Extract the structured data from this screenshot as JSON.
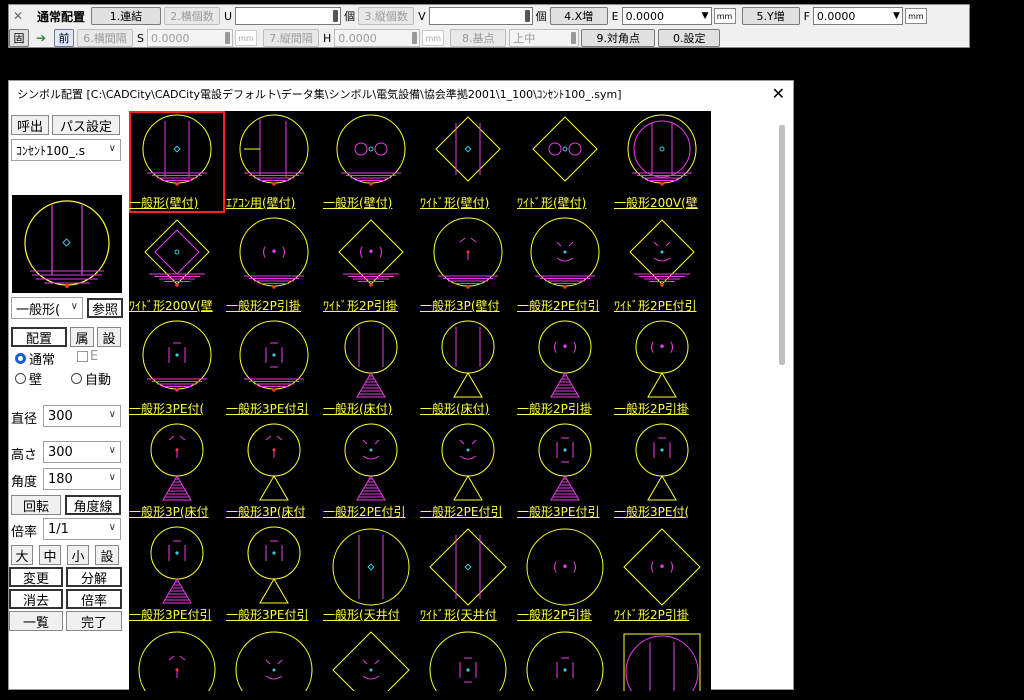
{
  "toolbar": {
    "title": "通常配置",
    "close_glyph": "✕",
    "row1": [
      {
        "label": "1.連結",
        "enabled": true
      },
      {
        "label": "2.横個数",
        "enabled": false
      }
    ],
    "u_label": "U",
    "u_unit": "個",
    "btn_tate": "3.縦個数",
    "v_label": "V",
    "v_unit": "個",
    "btn_xzo": "4.X増",
    "e_label": "E",
    "e_value": "0.0000",
    "btn_yzo": "5.Y増",
    "f_label": "F",
    "f_value": "0.0000",
    "mm": "mm",
    "row2_ko": "固",
    "row2_mae": "前",
    "btn_yokokan": "6.横間隔",
    "s_label": "S",
    "s_value": "0.0000",
    "btn_tatekan": "7.縦間隔",
    "h_label": "H",
    "h_value": "0.0000",
    "btn_kiten": "8.基点",
    "kiten_value": "上中",
    "btn_taikaku": "9.対角点",
    "btn_settei": "0.設定"
  },
  "dialog": {
    "title": "シンボル配置 [C:\\CADCity\\CADCity電設デフォルト\\データ集\\シンボル\\電気設備\\協会準拠2001\\1_100\\ｺﾝｾﾝﾄ100_.sym]",
    "close": "✕",
    "btn_yobidashi": "呼出",
    "btn_pass": "パス設定",
    "file_combo": "ｺﾝｾﾝﾄ100_.s",
    "name_combo": "一般形(",
    "btn_sansho": "参照",
    "tab_haichi": "配置",
    "tab_zoku": "属",
    "tab_setsu": "設",
    "radio_tsujo": "通常",
    "check_e": "E",
    "radio_kabe": "壁",
    "radio_jido": "自動",
    "lbl_chokkei": "直径",
    "chokkei": "300",
    "lbl_takasa": "高さ",
    "takasa": "300",
    "lbl_kakudo": "角度",
    "kakudo": "180",
    "btn_kaiten": "回転",
    "btn_kakudosen": "角度線",
    "lbl_bairitsu": "倍率",
    "bairitsu": "1/1",
    "btn_dai": "大",
    "btn_chu": "中",
    "btn_sho": "小",
    "btn_setsu2": "設",
    "btn_henko": "変更",
    "btn_bunkai": "分解",
    "btn_shokyo": "消去",
    "btn_bairitsu2": "倍率",
    "btn_ichiran": "一覧",
    "btn_kanryo": "完了"
  },
  "symbols": [
    {
      "label": "一般形(壁付)",
      "shape": "circle",
      "inner": "two-lines-dot",
      "base": "hatch",
      "selected": true
    },
    {
      "label": "ｴｱｺﾝ用(壁付)",
      "shape": "circle",
      "inner": "aircon",
      "base": "hatch"
    },
    {
      "label": "一般形(壁付)",
      "shape": "circle",
      "inner": "double",
      "base": "hatch"
    },
    {
      "label": "ﾜｲﾄﾞ形(壁付)",
      "shape": "diamond",
      "inner": "two-lines-dot",
      "base": "none"
    },
    {
      "label": "ﾜｲﾄﾞ形(壁付)",
      "shape": "diamond",
      "inner": "double",
      "base": "none"
    },
    {
      "label": "一般形200V(壁",
      "shape": "circle",
      "inner": "double-circle",
      "base": "hatch"
    },
    {
      "label": "ﾜｲﾄﾞ形200V(壁",
      "shape": "diamond",
      "inner": "diamond-inner",
      "base": "hatch"
    },
    {
      "label": "一般形2P引掛",
      "shape": "circle",
      "inner": "paren",
      "base": "hatch"
    },
    {
      "label": "ﾜｲﾄﾞ形2P引掛",
      "shape": "diamond",
      "inner": "paren",
      "base": "hatch"
    },
    {
      "label": "一般形3P(壁付",
      "shape": "circle",
      "inner": "3p",
      "base": "hatch"
    },
    {
      "label": "一般形2PE付引",
      "shape": "circle",
      "inner": "smile",
      "base": "hatch"
    },
    {
      "label": "ﾜｲﾄﾞ形2PE付引",
      "shape": "diamond",
      "inner": "smile",
      "base": "hatch"
    },
    {
      "label": "一般形3PE付(",
      "shape": "circle",
      "inner": "pe-box",
      "base": "hatch"
    },
    {
      "label": "一般形3PE付引",
      "shape": "circle",
      "inner": "pe-bar",
      "base": "hatch"
    },
    {
      "label": "一般形(床付)",
      "shape": "circle-small",
      "inner": "two-lines",
      "base": "tri-fill"
    },
    {
      "label": "一般形(床付)",
      "shape": "circle-small",
      "inner": "two-lines",
      "base": "tri"
    },
    {
      "label": "一般形2P引掛",
      "shape": "circle-small",
      "inner": "paren",
      "base": "tri-fill"
    },
    {
      "label": "一般形2P引掛",
      "shape": "circle-small",
      "inner": "paren",
      "base": "tri"
    },
    {
      "label": "一般形3P(床付",
      "shape": "circle-small",
      "inner": "3p",
      "base": "tri-fill"
    },
    {
      "label": "一般形3P(床付",
      "shape": "circle-small",
      "inner": "3p",
      "base": "tri"
    },
    {
      "label": "一般形2PE付引",
      "shape": "circle-small",
      "inner": "smile",
      "base": "tri-fill"
    },
    {
      "label": "一般形2PE付引",
      "shape": "circle-small",
      "inner": "smile",
      "base": "tri"
    },
    {
      "label": "一般形3PE付引",
      "shape": "circle-small",
      "inner": "pe-bar",
      "base": "tri-fill"
    },
    {
      "label": "一般形3PE付(",
      "shape": "circle-small",
      "inner": "pe-box",
      "base": "tri"
    },
    {
      "label": "一般形3PE付引",
      "shape": "circle-small",
      "inner": "pe-box",
      "base": "tri-fill"
    },
    {
      "label": "一般形3PE付引",
      "shape": "circle-small",
      "inner": "pe-box",
      "base": "tri"
    },
    {
      "label": "一般形(天井付",
      "shape": "circle-large",
      "inner": "two-lines-dot",
      "base": "none"
    },
    {
      "label": "ﾜｲﾄﾞ形(天井付",
      "shape": "diamond-large",
      "inner": "two-lines-dot",
      "base": "none"
    },
    {
      "label": "一般形2P引掛",
      "shape": "circle-large",
      "inner": "paren",
      "base": "none"
    },
    {
      "label": "ﾜｲﾄﾞ形2P引掛",
      "shape": "diamond-large",
      "inner": "paren",
      "base": "none"
    },
    {
      "label": "",
      "shape": "circle-large",
      "inner": "3p",
      "base": "none"
    },
    {
      "label": "",
      "shape": "circle-large",
      "inner": "smile",
      "base": "none"
    },
    {
      "label": "",
      "shape": "diamond-large",
      "inner": "smile",
      "base": "none"
    },
    {
      "label": "",
      "shape": "circle-large",
      "inner": "pe-bar",
      "base": "none"
    },
    {
      "label": "",
      "shape": "circle-large",
      "inner": "pe-box",
      "base": "none"
    },
    {
      "label": "",
      "shape": "square-circle",
      "inner": "two-lines",
      "base": "none"
    }
  ],
  "colors": {
    "symbol_line": "#ffff32",
    "symbol_inner": "#e83ce8",
    "symbol_dot": "#3cc8e0",
    "symbol_red": "#ff3030",
    "label": "#ffff3c"
  }
}
